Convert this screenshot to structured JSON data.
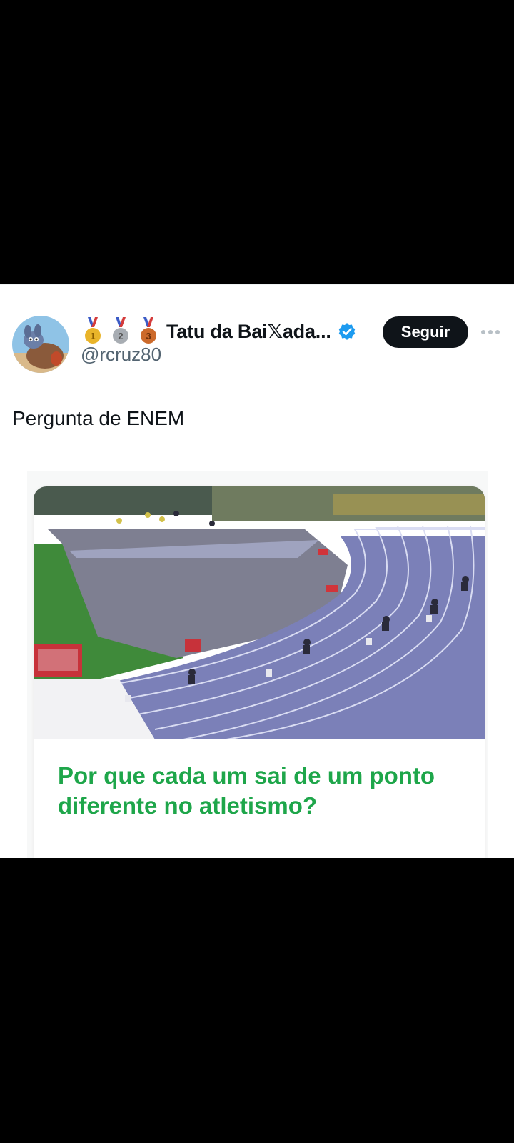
{
  "post": {
    "author": {
      "display_name": "Tatu da Bai𝕏ada...",
      "handle": "@rcruz80",
      "verified": true,
      "medals": [
        "1",
        "2",
        "3"
      ]
    },
    "follow_label": "Seguir",
    "text": "Pergunta de ENEM"
  },
  "media": {
    "caption": "Por que cada um sai de um ponto diferente no atletismo?"
  },
  "colors": {
    "caption_green": "#1ea64a",
    "follow_bg": "#0f1419",
    "verified_blue": "#1d9bf0",
    "handle_gray": "#536471"
  },
  "icons": [
    "more-options-icon",
    "verified-badge-icon",
    "gold-medal-icon",
    "silver-medal-icon",
    "bronze-medal-icon"
  ]
}
